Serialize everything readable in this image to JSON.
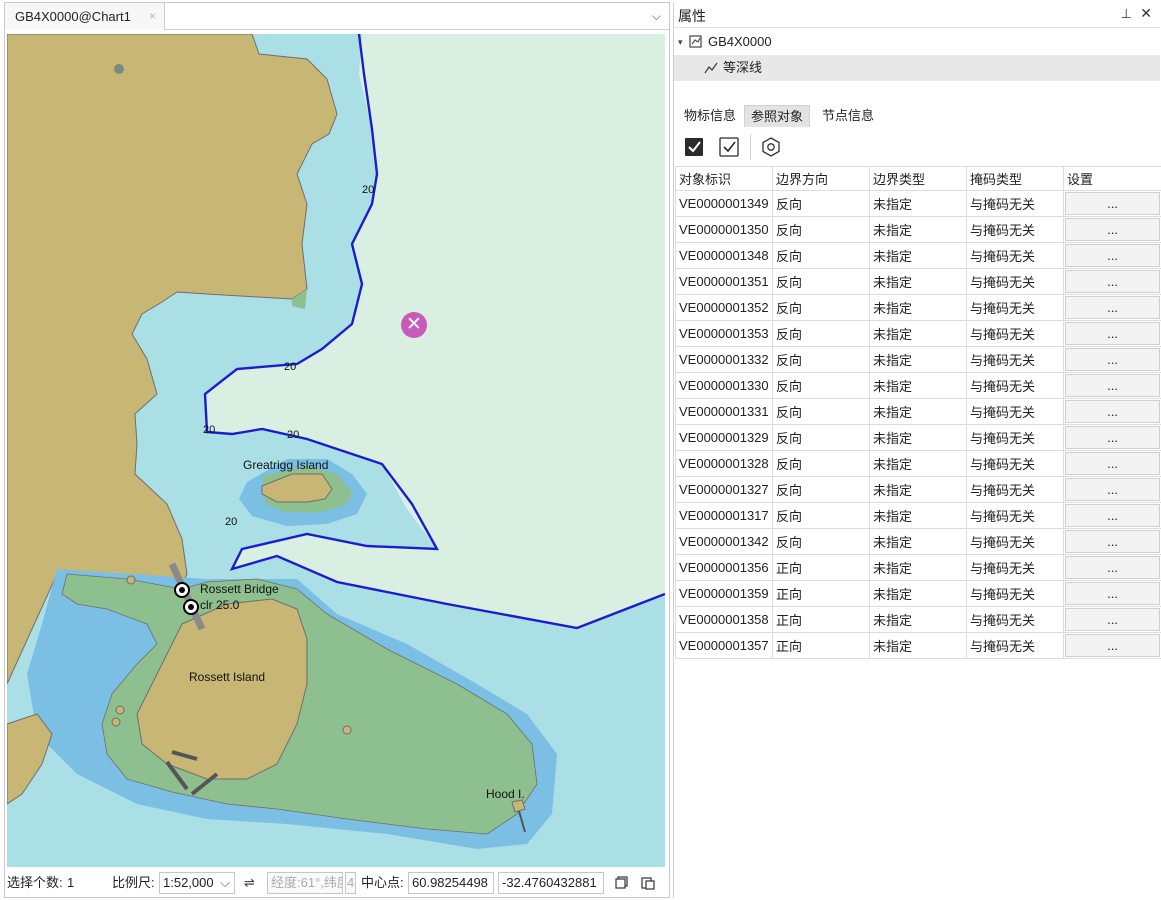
{
  "document": {
    "tab_title": "GB4X0000@Chart1",
    "tab_close": "×",
    "dropdown": "⌵"
  },
  "map": {
    "labels": {
      "greatrigg": "Greatrigg Island",
      "rossett_bridge": "Rossett Bridge",
      "clearance": "clr 25.0",
      "rossett_island": "Rossett Island",
      "hood": "Hood I."
    },
    "depth_labels": [
      "20",
      "20",
      "20",
      "20",
      "20"
    ],
    "colors": {
      "land": "#c8b774",
      "intertidal": "#8ebf8e",
      "shallow_water": "#7cbfe4",
      "medium_water": "#aadfe6",
      "deep_water": "#d8efe2",
      "depth_contour": "#1c1ccf",
      "marker": "#c85ab9"
    },
    "marker_glyph": "✕"
  },
  "status_bar": {
    "selection_label": "选择个数:",
    "selection_count": "1",
    "scale_label": "比例尺:",
    "scale_value": "1:52,000",
    "scale_dropdown": "⌵",
    "swap_icon": "⇌",
    "lon_placeholder": "经度:61°,纬度",
    "small_value": "4",
    "center_label": "中心点:",
    "center_x": "60.98254498",
    "center_y": "-32.4760432881"
  },
  "properties": {
    "title": "属性",
    "pin_icon": "⊥",
    "close_icon": "✕",
    "tree": {
      "root_label": "GB4X0000",
      "child_label": "等深线",
      "expander": "▾"
    },
    "tabs": [
      "物标信息",
      "参照对象",
      "节点信息"
    ],
    "active_tab": "参照对象",
    "grid": {
      "headers": [
        "对象标识",
        "边界方向",
        "边界类型",
        "掩码类型",
        "设置"
      ],
      "button_label": "...",
      "rows": [
        {
          "id": "VE0000001349",
          "dir": "反向",
          "type": "未指定",
          "mask": "与掩码无关"
        },
        {
          "id": "VE0000001350",
          "dir": "反向",
          "type": "未指定",
          "mask": "与掩码无关"
        },
        {
          "id": "VE0000001348",
          "dir": "反向",
          "type": "未指定",
          "mask": "与掩码无关"
        },
        {
          "id": "VE0000001351",
          "dir": "反向",
          "type": "未指定",
          "mask": "与掩码无关"
        },
        {
          "id": "VE0000001352",
          "dir": "反向",
          "type": "未指定",
          "mask": "与掩码无关"
        },
        {
          "id": "VE0000001353",
          "dir": "反向",
          "type": "未指定",
          "mask": "与掩码无关"
        },
        {
          "id": "VE0000001332",
          "dir": "反向",
          "type": "未指定",
          "mask": "与掩码无关"
        },
        {
          "id": "VE0000001330",
          "dir": "反向",
          "type": "未指定",
          "mask": "与掩码无关"
        },
        {
          "id": "VE0000001331",
          "dir": "反向",
          "type": "未指定",
          "mask": "与掩码无关"
        },
        {
          "id": "VE0000001329",
          "dir": "反向",
          "type": "未指定",
          "mask": "与掩码无关"
        },
        {
          "id": "VE0000001328",
          "dir": "反向",
          "type": "未指定",
          "mask": "与掩码无关"
        },
        {
          "id": "VE0000001327",
          "dir": "反向",
          "type": "未指定",
          "mask": "与掩码无关"
        },
        {
          "id": "VE0000001317",
          "dir": "反向",
          "type": "未指定",
          "mask": "与掩码无关"
        },
        {
          "id": "VE0000001342",
          "dir": "反向",
          "type": "未指定",
          "mask": "与掩码无关"
        },
        {
          "id": "VE0000001356",
          "dir": "正向",
          "type": "未指定",
          "mask": "与掩码无关"
        },
        {
          "id": "VE0000001359",
          "dir": "正向",
          "type": "未指定",
          "mask": "与掩码无关"
        },
        {
          "id": "VE0000001358",
          "dir": "正向",
          "type": "未指定",
          "mask": "与掩码无关"
        },
        {
          "id": "VE0000001357",
          "dir": "正向",
          "type": "未指定",
          "mask": "与掩码无关"
        }
      ]
    }
  }
}
